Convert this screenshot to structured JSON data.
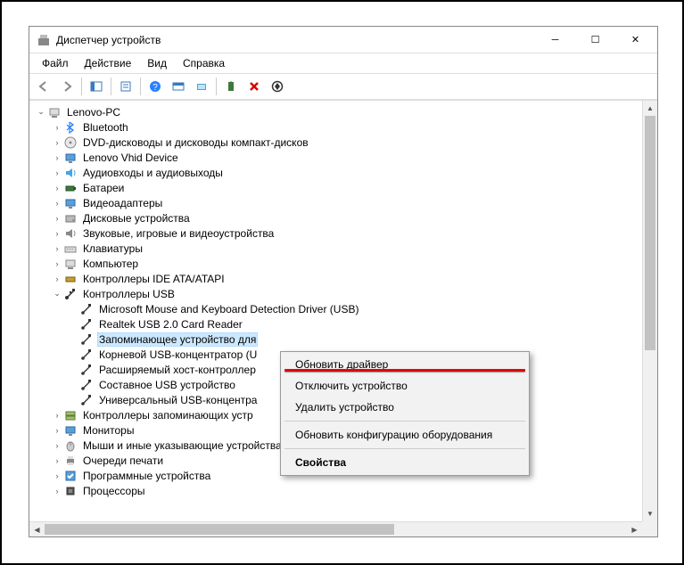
{
  "window": {
    "title": "Диспетчер устройств"
  },
  "menubar": {
    "items": [
      "Файл",
      "Действие",
      "Вид",
      "Справка"
    ]
  },
  "tree_root": "Lenovo-PC",
  "tree": {
    "items": [
      {
        "icon": "bluetooth",
        "label": "Bluetooth",
        "chev": ">"
      },
      {
        "icon": "disc",
        "label": "DVD-дисководы и дисководы компакт-дисков",
        "chev": ">"
      },
      {
        "icon": "monitor",
        "label": "Lenovo Vhid Device",
        "chev": ">"
      },
      {
        "icon": "audio",
        "label": "Аудиовходы и аудиовыходы",
        "chev": ">"
      },
      {
        "icon": "battery",
        "label": "Батареи",
        "chev": ">"
      },
      {
        "icon": "display",
        "label": "Видеоадаптеры",
        "chev": ">"
      },
      {
        "icon": "disk",
        "label": "Дисковые устройства",
        "chev": ">"
      },
      {
        "icon": "sound",
        "label": "Звуковые, игровые и видеоустройства",
        "chev": ">"
      },
      {
        "icon": "keyboard",
        "label": "Клавиатуры",
        "chev": ">"
      },
      {
        "icon": "computer",
        "label": "Компьютер",
        "chev": ">"
      },
      {
        "icon": "ide",
        "label": "Контроллеры IDE ATA/ATAPI",
        "chev": ">"
      },
      {
        "icon": "usb",
        "label": "Контроллеры USB",
        "chev": "v",
        "children": [
          {
            "icon": "usbdev",
            "label": "Microsoft Mouse and Keyboard Detection Driver (USB)"
          },
          {
            "icon": "usbdev",
            "label": "Realtek USB 2.0 Card Reader"
          },
          {
            "icon": "usbdev",
            "label": "Запоминающее устройство для",
            "sel": true
          },
          {
            "icon": "usbdev",
            "label": "Корневой USB-концентратор (U"
          },
          {
            "icon": "usbdev",
            "label": "Расширяемый хост-контроллер"
          },
          {
            "icon": "usbdev",
            "label": "Составное USB устройство"
          },
          {
            "icon": "usbdev",
            "label": "Универсальный USB-концентра"
          }
        ]
      },
      {
        "icon": "storage",
        "label": "Контроллеры запоминающих устр",
        "chev": ">"
      },
      {
        "icon": "monitor2",
        "label": "Мониторы",
        "chev": ">"
      },
      {
        "icon": "mouse",
        "label": "Мыши и иные указывающие устройства",
        "chev": ">"
      },
      {
        "icon": "printer",
        "label": "Очереди печати",
        "chev": ">"
      },
      {
        "icon": "software",
        "label": "Программные устройства",
        "chev": ">"
      },
      {
        "icon": "cpu",
        "label": "Процессоры",
        "chev": ">"
      }
    ]
  },
  "context_menu": {
    "items": [
      {
        "label": "Обновить драйвер",
        "hover": false
      },
      {
        "label": "Отключить устройство"
      },
      {
        "label": "Удалить устройство"
      },
      {
        "sep": true
      },
      {
        "label": "Обновить конфигурацию оборудования"
      },
      {
        "sep": true
      },
      {
        "label": "Свойства",
        "bold": true
      }
    ]
  }
}
